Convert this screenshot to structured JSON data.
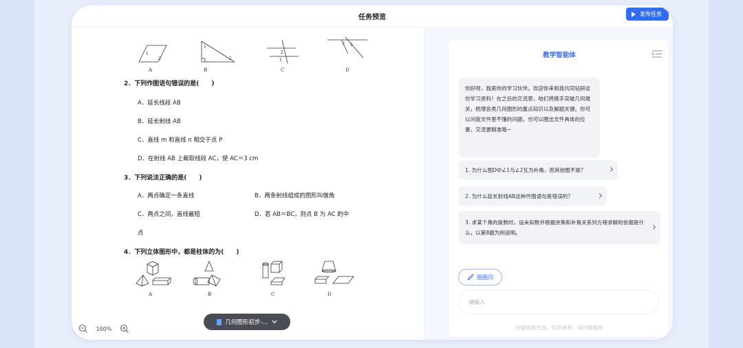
{
  "header": {
    "title": "任务预览",
    "publish_label": "发布任务"
  },
  "document": {
    "fig_row1_labels": [
      "A",
      "B",
      "C",
      "D"
    ],
    "q2": {
      "stem": "2．下列作图语句错误的是(　　)",
      "options": [
        "A．延长线段 AB",
        "B．延长射线 AB",
        "C．直线 m 和直线 n 相交于点 P",
        "D．在射线 AB 上截取线段 AC，使 AC＝3 cm"
      ]
    },
    "q3": {
      "stem": "3．下列说法正确的是(　　)",
      "options": [
        "A．两点确定一条直线",
        "B．两条射线组成的图形叫做角",
        "C．两点之间，直线最短",
        "D．若 AB＝BC，则点 B 为 AC 的中",
        "点"
      ]
    },
    "q4": {
      "stem": "4．下列立体图形中，都是柱体的为(　　)"
    },
    "fig_row2_labels": [
      "A",
      "B",
      "C",
      "D"
    ],
    "zoom_level": "100%",
    "file_chip": "几何图形初步-..."
  },
  "assistant": {
    "title": "教学智能体",
    "greeting": "你好呀，我是你的学习伙伴。欢迎你来和我共同钻研这份学习资料！在之后的交流里，咱们将携手突破几何难关，梳理各类几何图形的重点知识以及解题关键。你可以问我文件里不懂的问题，也可以圈出文件具体的位置，交流更精准哦~",
    "suggestions": [
      "1. 为什么图D中∠1与∠2互为补角，而其他图不是？",
      "2. 为什么延长射线AB这种作图语句是错误的？",
      "3. 求某个角的度数时，设未知数并根据余角和补角关系列方程求解的依据是什么，以第8题为例说明。"
    ],
    "circle_button": "圈圈问",
    "input_placeholder": "请输入",
    "disclaimer": "回复由AI生成，仅供参考，请仔细甄别"
  },
  "colors": {
    "accent": "#3b6ef5",
    "publish_bg": "#2f6df6",
    "chip_bg": "#4a4d55"
  }
}
